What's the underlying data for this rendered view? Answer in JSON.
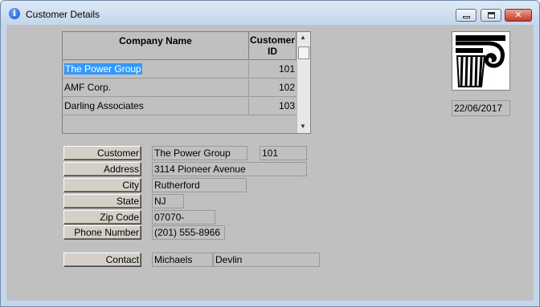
{
  "window": {
    "title": "Customer Details",
    "close_glyph": "✕"
  },
  "grid": {
    "headers": {
      "company": "Company Name",
      "id_line1": "Customer",
      "id_line2": "ID"
    },
    "rows": [
      {
        "company": "The Power Group",
        "id": "101",
        "selected": true
      },
      {
        "company": "AMF Corp.",
        "id": "102"
      },
      {
        "company": "Darling Associates",
        "id": "103"
      }
    ]
  },
  "date": "22/06/2017",
  "form": {
    "customer_label": "Customer",
    "customer_name": "The Power Group",
    "customer_id": "101",
    "address_label": "Address",
    "address": "3114 Pioneer Avenue",
    "city_label": "City",
    "city": "Rutherford",
    "state_label": "State",
    "state": "NJ",
    "zip_label": "Zip Code",
    "zip": "07070-",
    "phone_label": "Phone Number",
    "phone": "(201) 555-8966",
    "contact_label": "Contact",
    "contact_first": "Michaels",
    "contact_last": "Devlin"
  },
  "icons": {
    "title": "info-icon",
    "logo": "column-capital-logo"
  }
}
